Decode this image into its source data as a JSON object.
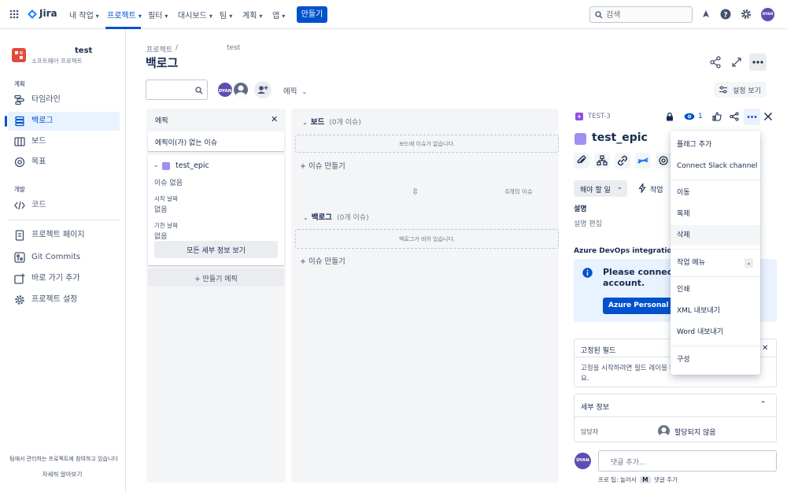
{
  "nav": {
    "logo": "Jira",
    "items": [
      {
        "label": "내 작업"
      },
      {
        "label": "프로젝트"
      },
      {
        "label": "필터"
      },
      {
        "label": "대시보드"
      },
      {
        "label": "팀"
      },
      {
        "label": "계획"
      },
      {
        "label": "앱"
      }
    ],
    "create": "만들기",
    "search_placeholder": "검색",
    "avatar": "DYAN"
  },
  "sidebar": {
    "project_name": "test",
    "project_type": "소프트웨어 프로젝트",
    "section_plan": "계획",
    "plan_items": [
      {
        "label": "타임라인"
      },
      {
        "label": "백로그"
      },
      {
        "label": "보드"
      },
      {
        "label": "목표"
      }
    ],
    "section_dev": "개발",
    "dev_items": [
      {
        "label": "코드"
      }
    ],
    "other_items": [
      {
        "label": "프로젝트 페이지"
      },
      {
        "label": "Git Commits"
      },
      {
        "label": "바로 가기 추가"
      },
      {
        "label": "프로젝트 설정"
      }
    ],
    "footer_text": "팀에서 관리하는 프로젝트에 참여하고 있습니다",
    "footer_link": "자세히 알아보기"
  },
  "breadcrumb": {
    "projects": "프로젝트",
    "sep": "/",
    "project": "test"
  },
  "page_title": "백로그",
  "toolbar": {
    "avatar": "DYAN",
    "epic_filter": "에픽",
    "settings": "설정 보기"
  },
  "epic_panel": {
    "title": "에픽",
    "no_epic": "에픽이(가) 없는 이슈",
    "epic_name": "test_epic",
    "issues": "이슈 없음",
    "start_label": "시작 날짜",
    "start_value": "없음",
    "due_label": "기한 날짜",
    "due_value": "없음",
    "details_btn": "모든 세부 정보 보기",
    "create_epic": "+ 만들기 에픽"
  },
  "board": {
    "title": "보드",
    "count": "(0개 이슈)",
    "empty": "보드에 이슈가 없습니다.",
    "create_issue": "+ 이슈 만들기",
    "summary": "0개의 이슈"
  },
  "backlog": {
    "title": "백로그",
    "count": "(0개 이슈)",
    "empty": "백로그가 비어 있습니다.",
    "create_issue": "+ 이슈 만들기"
  },
  "detail": {
    "key": "TEST-3",
    "watch_count": "1",
    "title": "test_epic",
    "status": "해야 할 일",
    "action": "작업",
    "desc_label": "설명",
    "desc_edit": "설명 편집",
    "azure_label": "Azure DevOps integration fo",
    "azure_msg": "Please connect yo",
    "azure_msg2": "account.",
    "azure_btn": "Azure Personal Ac",
    "pinned_title": "고정된 필드",
    "pinned_text": "고정을 시작하려면 필드 레이블 위",
    "pinned_text2": "요.",
    "details_title": "세부 정보",
    "assignee_label": "담당자",
    "assignee_value": "할당되지 않음",
    "comment_placeholder": "댓글 추가...",
    "tip": "프로 팁: 눌러서",
    "tip_key": "M",
    "tip_suffix": "댓글 추가",
    "comment_avatar": "DYAN"
  },
  "menu": {
    "items": [
      {
        "label": "플래그 추가"
      },
      {
        "label": "Connect Slack channel"
      },
      {
        "label": "이동"
      },
      {
        "label": "복제"
      },
      {
        "label": "삭제"
      },
      {
        "label": "작업 메뉴"
      },
      {
        "label": "인쇄"
      },
      {
        "label": "XML 내보내기"
      },
      {
        "label": "Word 내보내기"
      },
      {
        "label": "구성"
      }
    ],
    "shortcut": "."
  },
  "colors": {
    "brand": "#0052cc",
    "epic": "#9f8fef",
    "avatar": "#5e4db2"
  }
}
